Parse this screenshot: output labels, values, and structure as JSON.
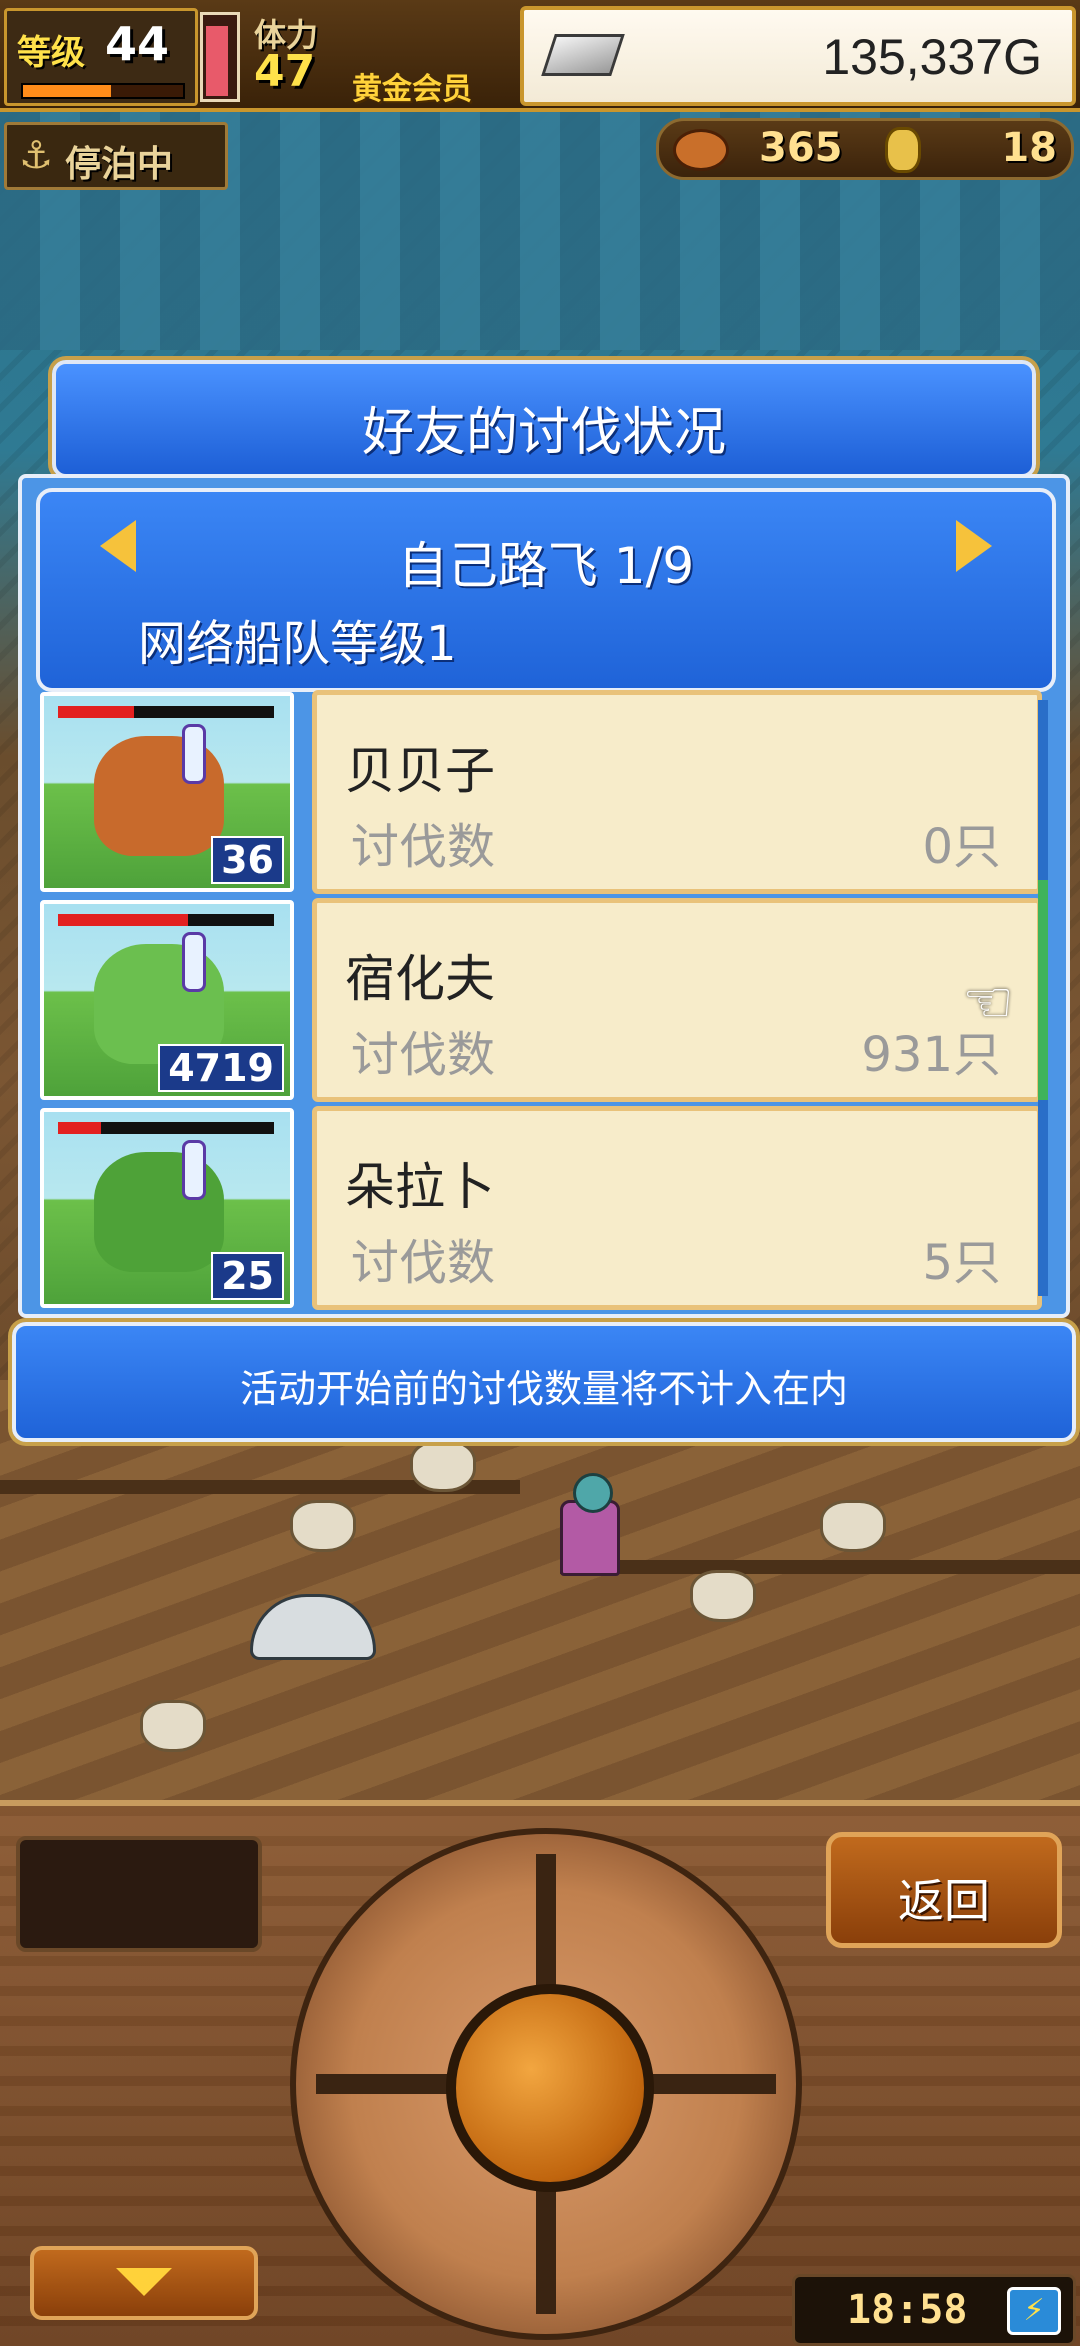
{
  "hud": {
    "level_label": "等级",
    "level": "44",
    "level_progress": 0.55,
    "stamina_label": "体力",
    "stamina": "47",
    "stamina_fill": 0.9,
    "membership": "黄金会员",
    "gold": "135,337G",
    "status": "停泊中",
    "food": "365",
    "coins": "18"
  },
  "dialog": {
    "title": "好友的讨伐状况",
    "player": "自己路飞 1/9",
    "fleet_level": "网络船队等级1",
    "notice": "活动开始前的讨伐数量将不计入在内"
  },
  "monsters": [
    {
      "name": "贝贝子",
      "kill_label": "讨伐数",
      "kills": "0只",
      "count": "36",
      "hp": 0.35,
      "color": "#c86a2c"
    },
    {
      "name": "宿化夫",
      "kill_label": "讨伐数",
      "kills": "931只",
      "count": "4719",
      "hp": 0.6,
      "color": "#6bbf4f"
    },
    {
      "name": "朵拉卜",
      "kill_label": "讨伐数",
      "kills": "5只",
      "count": "25",
      "hp": 0.2,
      "color": "#4ea238"
    }
  ],
  "controls": {
    "back_label": "返回",
    "clock": "18:58"
  },
  "icons": {
    "anchor": "anchor-icon",
    "silver_bar": "silver-bar-icon",
    "food": "meat-icon",
    "coin": "coin-icon",
    "pointer": "pointing-hand-icon",
    "battery": "battery-charging-icon"
  }
}
